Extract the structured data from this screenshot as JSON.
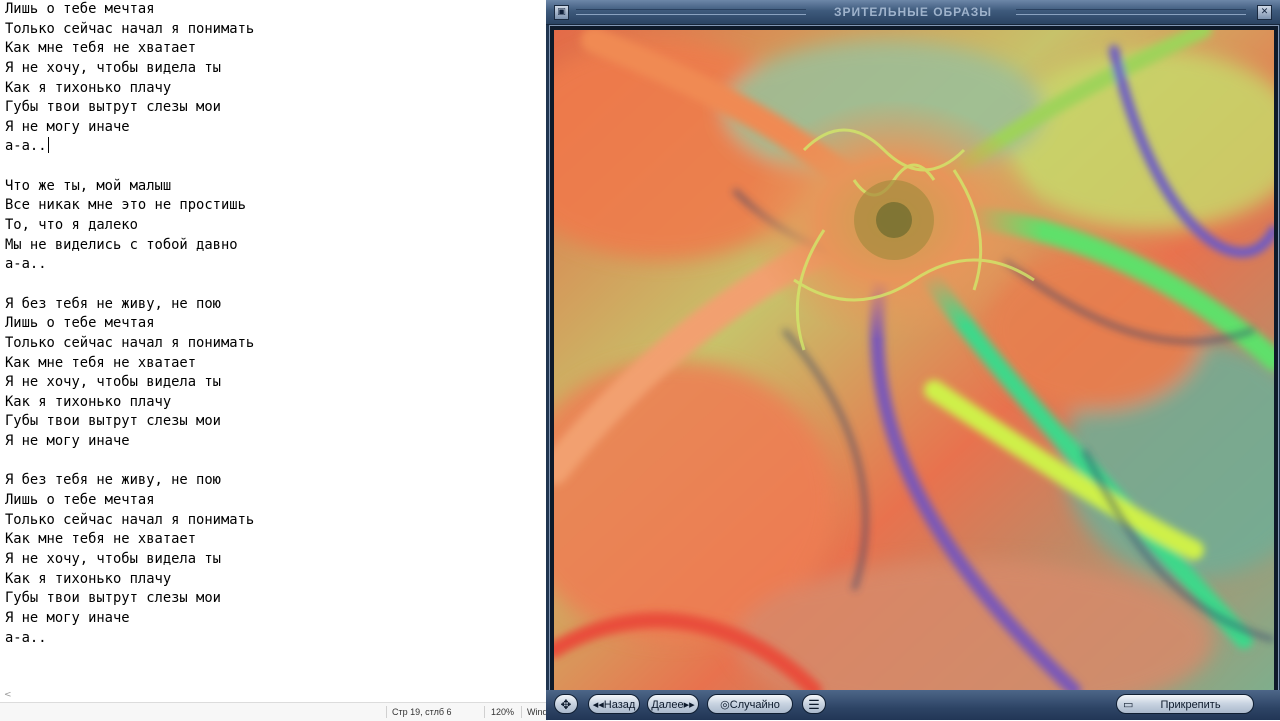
{
  "editor": {
    "lines": [
      "Лишь о тебе мечтая",
      "Только сейчас начал я понимать",
      "Как мне тебя не хватает",
      "Я не хочу, чтобы видела ты",
      "Как я тихонько плачу",
      "Губы твои вытрут слезы мои",
      "Я не могу иначе",
      "а-а..",
      "",
      "Что же ты, мой малыш",
      "Все никак мне это не простишь",
      "То, что я далеко",
      "Мы не виделись с тобой давно",
      "а-а..",
      "",
      "Я без тебя не живу, не пою",
      "Лишь о тебе мечтая",
      "Только сейчас начал я понимать",
      "Как мне тебя не хватает",
      "Я не хочу, чтобы видела ты",
      "Как я тихонько плачу",
      "Губы твои вытрут слезы мои",
      "Я не могу иначе",
      "",
      "Я без тебя не живу, не пою",
      "Лишь о тебе мечтая",
      "Только сейчас начал я понимать",
      "Как мне тебя не хватает",
      "Я не хочу, чтобы видела ты",
      "Как я тихонько плачу",
      "Губы твои вытрут слезы мои",
      "Я не могу иначе",
      "а-а.."
    ],
    "status": {
      "position": "Стр 19, стлб 6",
      "zoom": "120%",
      "encoding": "Wind"
    },
    "scroll_arrow": "<"
  },
  "player": {
    "title": "ЗРИТЕЛЬНЫЕ ОБРАЗЫ",
    "buttons": {
      "back": "Назад",
      "next": "Далее",
      "random": "Случайно",
      "pin": "Прикрепить"
    },
    "icons": {
      "window": "window-icon",
      "close": "close-icon",
      "move": "move-icon",
      "menu": "menu-icon",
      "back": "double-left-arrow-icon",
      "next": "double-right-arrow-icon",
      "random": "random-icon",
      "pin": "pin-icon"
    }
  }
}
